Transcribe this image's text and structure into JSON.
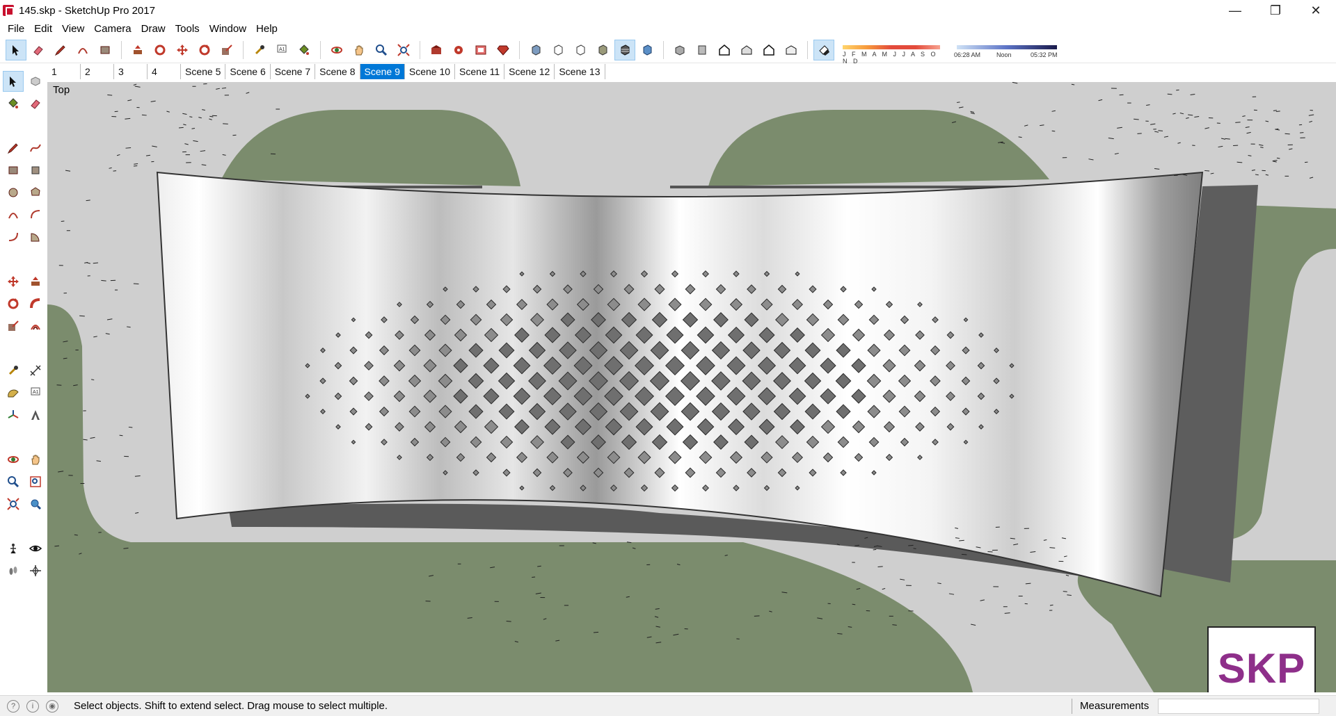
{
  "window": {
    "title": "145.skp - SketchUp Pro 2017",
    "minimize_glyph": "—",
    "maximize_glyph": "❐",
    "close_glyph": "✕"
  },
  "menu": {
    "file": "File",
    "edit": "Edit",
    "view": "View",
    "camera": "Camera",
    "draw": "Draw",
    "tools": "Tools",
    "window": "Window",
    "help": "Help"
  },
  "toolbar_icons": [
    "select-icon",
    "eraser-icon",
    "pencil-icon",
    "arc-icon",
    "rectangle-icon",
    "push-pull-icon",
    "follow-me-icon",
    "move-icon",
    "rotate-icon",
    "scale-icon",
    "tape-measure-icon",
    "text-icon",
    "paint-bucket-icon",
    "orbit-icon",
    "pan-icon",
    "zoom-icon",
    "zoom-extents-icon",
    "warehouse-icon",
    "share-model-icon",
    "extension-warehouse-icon",
    "ruby-icon",
    "xray-icon",
    "wireframe-icon",
    "hidden-line-icon",
    "shaded-icon",
    "shaded-textures-icon",
    "iso-view-icon",
    "top-view-icon",
    "front-view-icon",
    "right-view-icon",
    "back-view-icon",
    "left-view-icon",
    "shadows-icon"
  ],
  "shadow_settings": {
    "months_label": "J F M A M J J A S O N D",
    "time_start": "06:28 AM",
    "time_mid": "Noon",
    "time_end": "05:32 PM",
    "month_level": 0.5,
    "time_level": 0.72
  },
  "scenes": {
    "tabs": [
      "1",
      "2",
      "3",
      "4",
      "Scene 5",
      "Scene 6",
      "Scene 7",
      "Scene 8",
      "Scene 9",
      "Scene 10",
      "Scene 11",
      "Scene 12",
      "Scene 13"
    ],
    "active": "Scene 9"
  },
  "viewport": {
    "view_name": "Top",
    "logo_text": "SKP",
    "colors": {
      "ground": "#cfcfcf",
      "lawn": "#7a8b6c",
      "wall_light": "#ffffff",
      "wall_dark": "#8a8a8a",
      "hole": "#7b7b7b",
      "shadow": "#5a5a5a"
    }
  },
  "statusbar": {
    "message": "Select objects. Shift to extend select. Drag mouse to select multiple.",
    "measurements_label": "Measurements",
    "measurements_value": ""
  }
}
